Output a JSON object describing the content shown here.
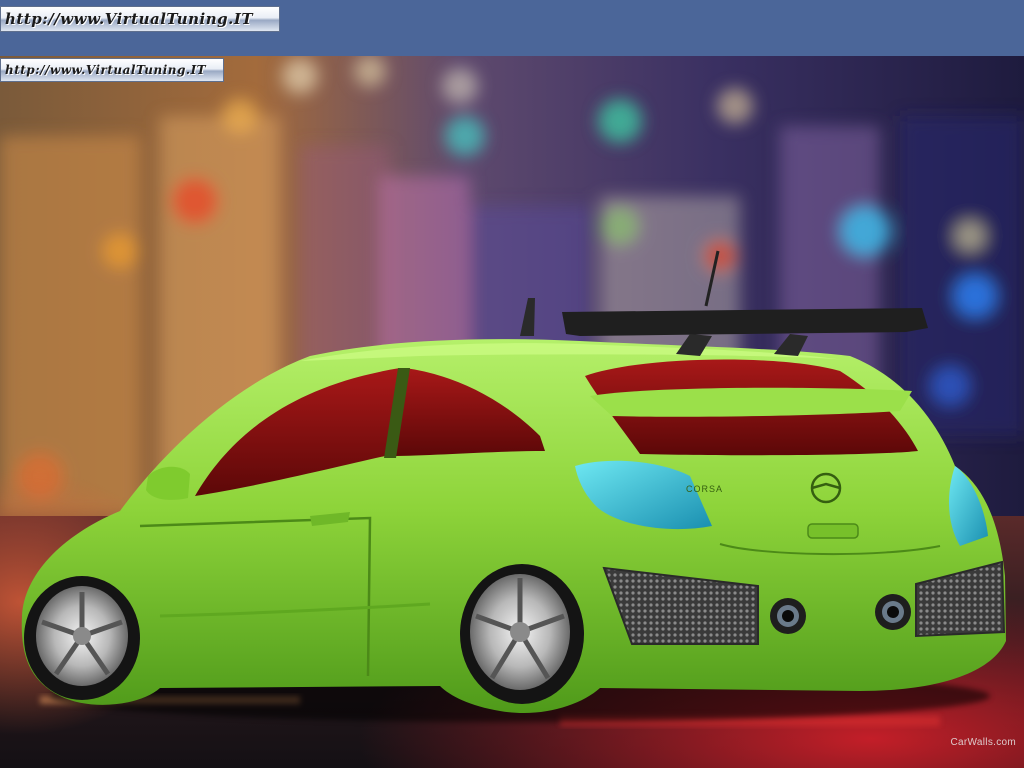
{
  "watermark": {
    "top_text": "http://www.VirtualTuning.IT",
    "second_text": "http://www.VirtualTuning.IT"
  },
  "credit": {
    "text": "CarWalls.com"
  },
  "car": {
    "badge": "CORSA",
    "color": "#8ed43a"
  },
  "icons": {
    "brand_logo": "opel-logo-icon"
  },
  "colors": {
    "header": "#4b6699",
    "car_body": "#8ed43a",
    "windows": "#8a1010",
    "tail_lights": "#39c3d6"
  }
}
